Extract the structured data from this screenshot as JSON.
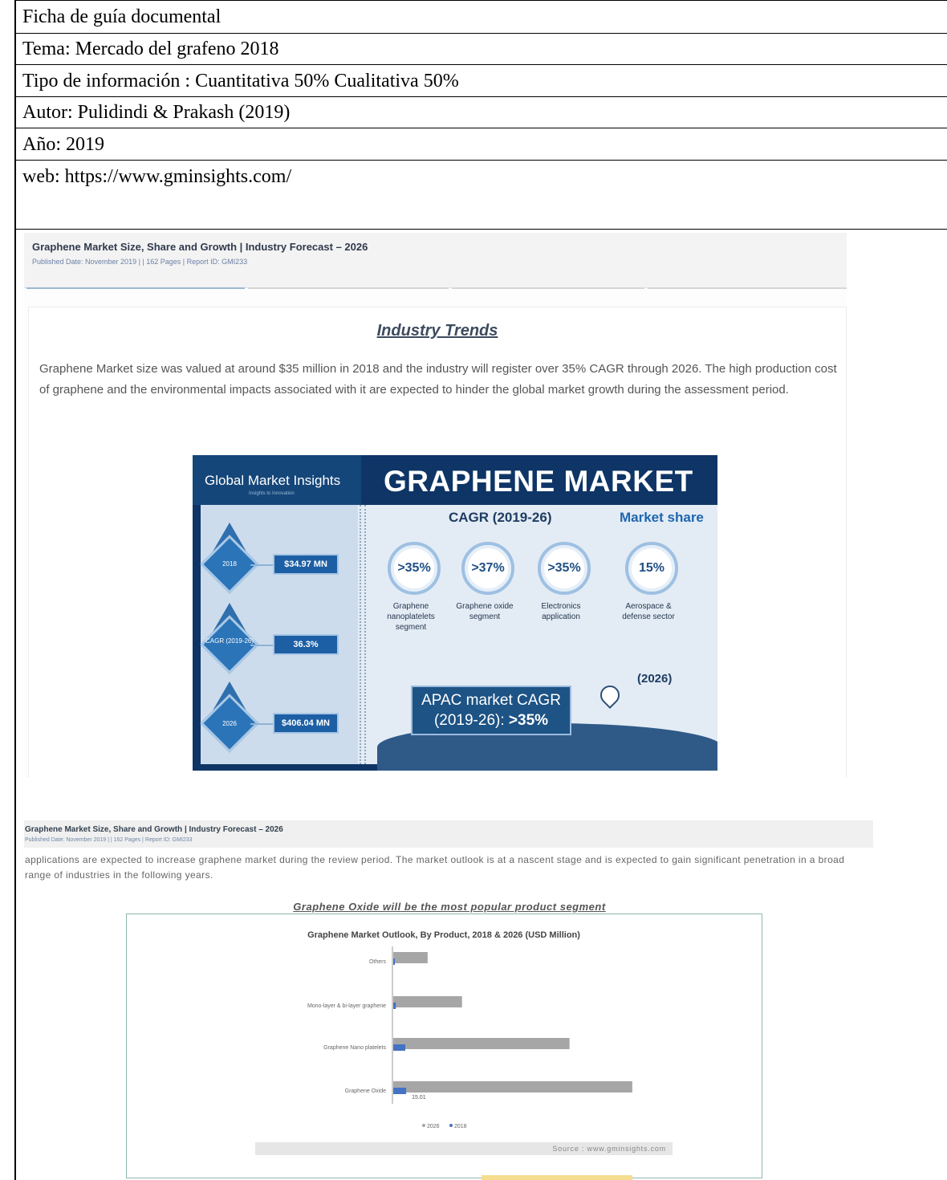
{
  "document": {
    "rows": [
      {
        "text": "Ficha de guía documental"
      },
      {
        "text": "Tema: Mercado del grafeno 2018"
      },
      {
        "text": "Tipo de información : Cuantitativa 50% Cualitativa 50%"
      },
      {
        "text": "Autor: Pulidindi & Prakash (2019)"
      },
      {
        "text": "Año: 2019"
      },
      {
        "text": "web:  https://www.gminsights.com/"
      }
    ]
  },
  "screenshot1": {
    "title": "Graphene Market Size, Share and Growth | Industry Forecast – 2026",
    "meta": "Published Date: November 2019 |   | 162 Pages | Report ID: GMI233",
    "heading": "Industry Trends",
    "paragraph": "Graphene Market size was valued at around $35 million in 2018 and the industry will register over 35% CAGR through 2026. The high production cost of graphene and the environmental impacts associated with it are expected to hinder the global market growth during the assessment period.",
    "infographic": {
      "brand": "Global Market Insights",
      "brand_sub": "Insights to Innovation",
      "title": "GRAPHENE MARKET",
      "timeline": [
        {
          "label": "2018",
          "value": "$34.97 MN"
        },
        {
          "label": "CAGR (2019-26)",
          "value": "36.3%"
        },
        {
          "label": "2026",
          "value": "$406.04 MN"
        }
      ],
      "cagr_heading": "CAGR (2019-26)",
      "share_heading": "Market share",
      "metrics": [
        {
          "value": ">35%",
          "label": "Graphene nanoplatelets segment"
        },
        {
          "value": ">37%",
          "label": "Graphene oxide segment"
        },
        {
          "value": ">35%",
          "label": "Electronics application"
        },
        {
          "value": "15%",
          "label": "Aerospace & defense sector"
        }
      ],
      "share_year": "(2026)",
      "apac_line1": "APAC market CAGR",
      "apac_line2": "(2019-26): ",
      "apac_value": ">35%"
    }
  },
  "screenshot2": {
    "title": "Graphene Market Size, Share and Growth | Industry Forecast – 2026",
    "meta": "Published Date: November 2019 |   | 162 Pages | Report ID: GMI233",
    "paragraph": "applications are expected to increase graphene market during the review period. The market outlook is at a nascent stage and is expected to gain significant penetration in a broad range of industries in the following years.",
    "heading": "Graphene Oxide will be the most popular product segment",
    "source": "Source : www.gminsights.com"
  },
  "chart_data": {
    "type": "bar",
    "orientation": "horizontal",
    "title": "Graphene Market Outlook, By Product, 2018 & 2026 (USD Million)",
    "categories": [
      "Others",
      "Mono-layer & bi-layer graphene",
      "Graphene Nano platelets",
      "Graphene Oxide"
    ],
    "series": [
      {
        "name": "2026",
        "values": [
          40,
          80,
          205,
          278
        ],
        "color": "#a6a6a6"
      },
      {
        "name": "2018",
        "values": [
          1.5,
          3,
          14,
          15.01
        ],
        "color": "#4472c4"
      }
    ],
    "data_labels": [
      {
        "series": "2018",
        "category": "Graphene Oxide",
        "text": "15.01"
      }
    ],
    "legend": "bottom-center",
    "grid": false
  }
}
